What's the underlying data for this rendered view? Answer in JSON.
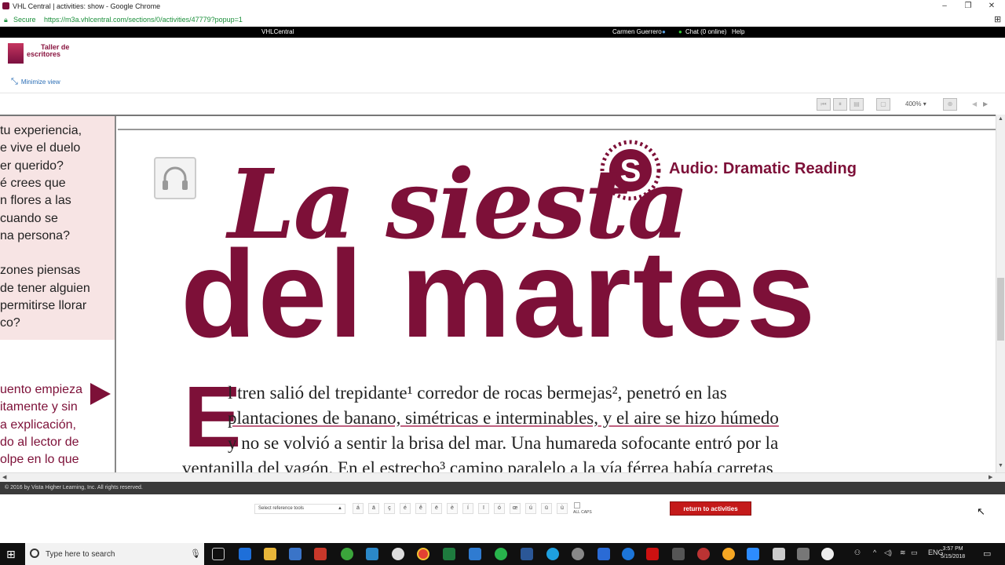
{
  "window": {
    "title": "VHL Central | activities: show - Google Chrome",
    "controls": [
      "–",
      "❐",
      "✕"
    ]
  },
  "addressbar": {
    "secure_label": "Secure",
    "url": "https://m3a.vhlcentral.com/sections/0/activities/47779?popup=1"
  },
  "vhlbar": {
    "brand": "VHLCentral",
    "user": "Carmen Guerrero",
    "chat": "Chat (0 online)",
    "help": "Help"
  },
  "header": {
    "logo_line1": "Taller de",
    "logo_line2": "escritores",
    "minimize_label": "Minimize view"
  },
  "toolbar": {
    "zoom": "400%"
  },
  "left_panel": {
    "question_lines": [
      "tu experiencia,",
      "e vive el duelo",
      "er querido?",
      "é crees que",
      "n flores a las",
      "cuando se",
      "na persona?",
      "",
      "zones piensas",
      "de tener alguien",
      "permitirse llorar",
      "co?"
    ],
    "reading_lines": [
      "uento empieza",
      "itamente y sin",
      "a explicación,",
      "do al lector de",
      "olpe en lo que"
    ]
  },
  "page": {
    "audio_label": "Audio: Dramatic Reading",
    "title_line1": "La siesta",
    "title_line2": "del martes",
    "drop_cap": "E",
    "text_lines": [
      "l tren salió del trepidante¹ corredor de rocas bermejas², penetró en las",
      "plantaciones de banano, simétricas e interminables, y el aire se hizo húmedo",
      "y no se volvió a sentir la brisa del mar. Una humareda sofocante entró por la",
      "ventanilla del vagón. En el estrecho³ camino paralelo a la vía férrea había carretas"
    ]
  },
  "footer": {
    "copyright": "© 2016 by Vista Higher Learning, Inc. All rights reserved.",
    "ref_select": "Select reference tools",
    "accents": [
      "á",
      "ä",
      "ç",
      "é",
      "ê",
      "ë",
      "è",
      "í",
      "ï",
      "ó",
      "œ",
      "ú",
      "ü",
      "ù"
    ],
    "allcaps": "ALL CAPS",
    "return_button": "return to activities"
  },
  "taskbar": {
    "search_placeholder": "Type here to search",
    "lang": "ENG",
    "time": "3:57 PM",
    "date": "5/15/2018"
  },
  "colors": {
    "brand_maroon": "#7d1038",
    "return_red": "#c41a1a",
    "secure_green": "#1a8f3a"
  }
}
